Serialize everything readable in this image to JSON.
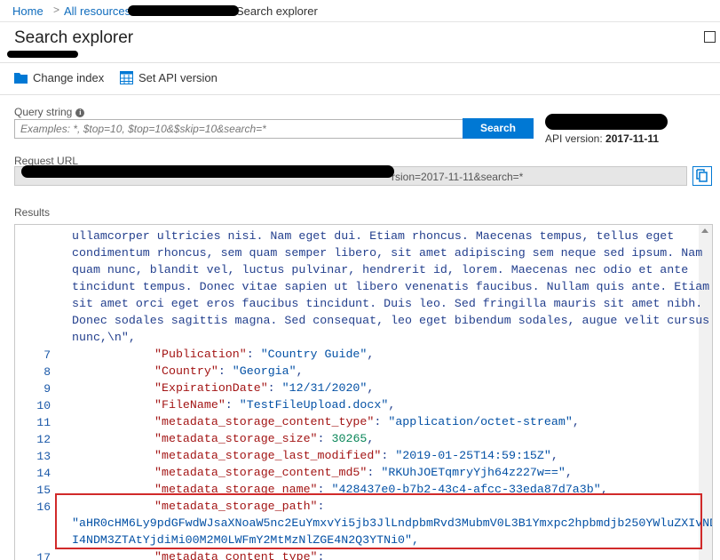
{
  "breadcrumb": {
    "home": "Home",
    "sep": ">",
    "all_resources": "All resources",
    "current": "Search explorer"
  },
  "page": {
    "title": "Search explorer"
  },
  "toolbar": {
    "change_index": "Change index",
    "set_api_version": "Set API version"
  },
  "query": {
    "label": "Query string",
    "placeholder": "Examples: *, $top=10, $top=10&$skip=10&search=*",
    "search_button": "Search"
  },
  "api": {
    "label": "API version:",
    "value": "2017-11-11"
  },
  "request_url": {
    "label": "Request URL",
    "visible_tail": "rsion=2017-11-11&search=*"
  },
  "results": {
    "label": "Results",
    "body_text_lines": [
      "ullamcorper ultricies nisi. Nam eget dui. Etiam rhoncus. Maecenas tempus, tellus eget",
      "condimentum rhoncus, sem quam semper libero, sit amet adipiscing sem neque sed ipsum. Nam",
      "quam nunc, blandit vel, luctus pulvinar, hendrerit id, lorem. Maecenas nec odio et ante",
      "tincidunt tempus. Donec vitae sapien ut libero venenatis faucibus. Nullam quis ante. Etiam",
      "sit amet orci eget eros faucibus tincidunt. Duis leo. Sed fringilla mauris sit amet nibh.",
      "Donec sodales sagittis magna. Sed consequat, leo eget bibendum sodales, augue velit cursus",
      "nunc,\\n\","
    ],
    "lines": [
      {
        "n": "7",
        "key": "\"Publication\"",
        "val": "\"Country Guide\"",
        "type": "str",
        "tail": ","
      },
      {
        "n": "8",
        "key": "\"Country\"",
        "val": "\"Georgia\"",
        "type": "str",
        "tail": ","
      },
      {
        "n": "9",
        "key": "\"ExpirationDate\"",
        "val": "\"12/31/2020\"",
        "type": "str",
        "tail": ","
      },
      {
        "n": "10",
        "key": "\"FileName\"",
        "val": "\"TestFileUpload.docx\"",
        "type": "str",
        "tail": ","
      },
      {
        "n": "11",
        "key": "\"metadata_storage_content_type\"",
        "val": "\"application/octet-stream\"",
        "type": "str",
        "tail": ","
      },
      {
        "n": "12",
        "key": "\"metadata_storage_size\"",
        "val": "30265",
        "type": "num",
        "tail": ","
      },
      {
        "n": "13",
        "key": "\"metadata_storage_last_modified\"",
        "val": "\"2019-01-25T14:59:15Z\"",
        "type": "str",
        "tail": ","
      },
      {
        "n": "14",
        "key": "\"metadata_storage_content_md5\"",
        "val": "\"RKUhJOETqmryYjh64z227w==\"",
        "type": "str",
        "tail": ","
      },
      {
        "n": "15",
        "key": "\"metadata_storage_name\"",
        "val": "\"428437e0-b7b2-43c4-afcc-33eda87d7a3b\"",
        "type": "str",
        "tail": ","
      },
      {
        "n": "16",
        "key": "\"metadata_storage_path\"",
        "val": "",
        "type": "str",
        "tail": ""
      },
      {
        "n": "17",
        "key": "\"metadata_content_type\"",
        "val": "",
        "type": "str",
        "tail": ""
      }
    ],
    "path_value_line1": "\"aHR0cHM6Ly9pdGFwdWJsaXNoaW5nc2EuYmxvYi5jb3JlLndpbmRvd3MubmV0L3B1Ymxpc2hpbmdjb250YWluZXIvND",
    "path_value_line2": "I4NDM3ZTAtYjdiMi00M2M0LWFmY2MtMzNlZGE4N2Q3YTNi0\","
  }
}
